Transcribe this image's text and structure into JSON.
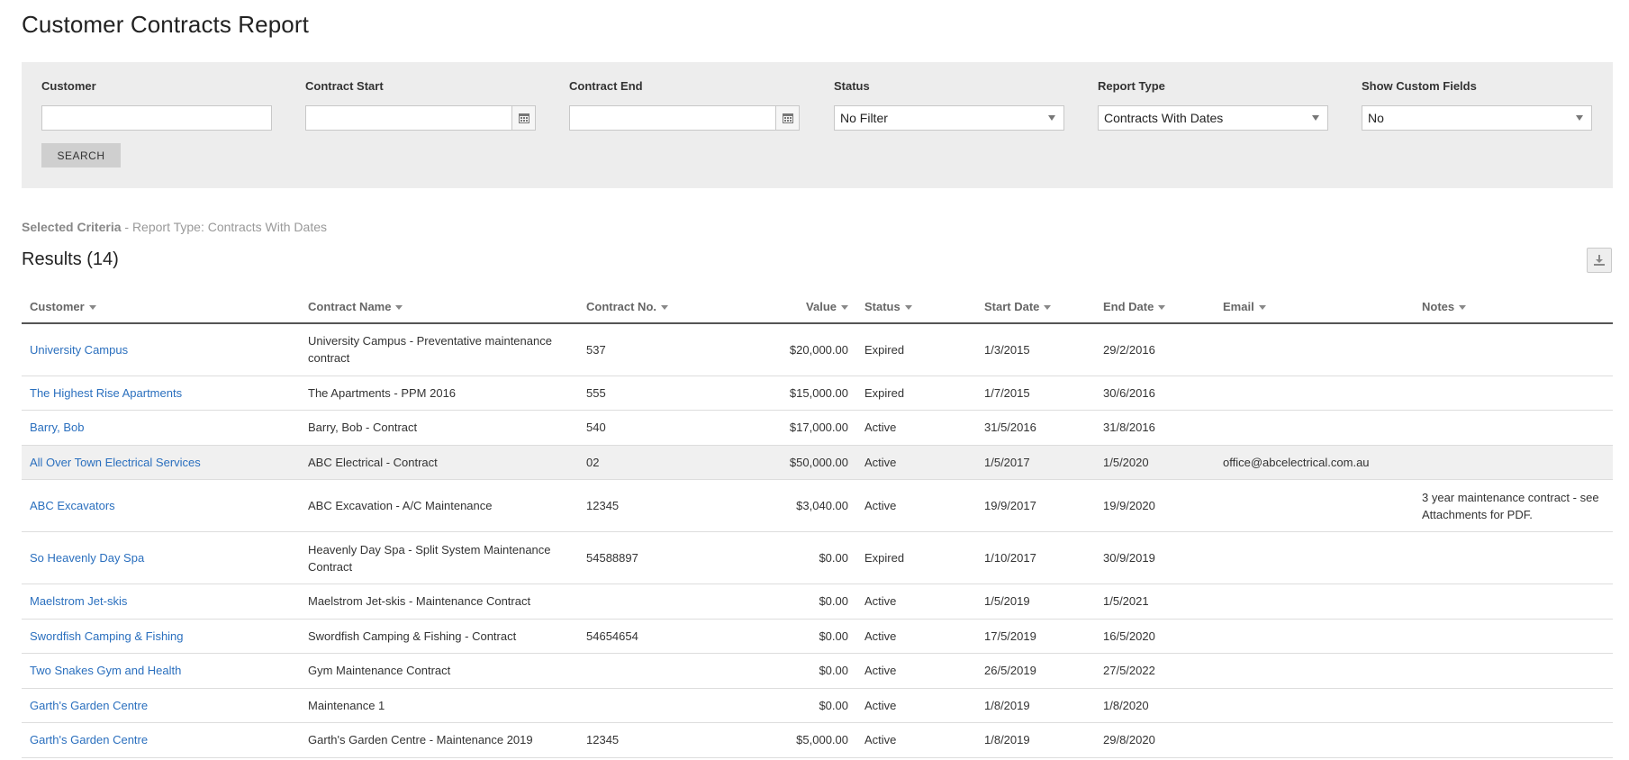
{
  "page": {
    "title": "Customer Contracts Report"
  },
  "filters": {
    "customer": {
      "label": "Customer",
      "value": ""
    },
    "contract_start": {
      "label": "Contract Start",
      "value": ""
    },
    "contract_end": {
      "label": "Contract End",
      "value": ""
    },
    "status": {
      "label": "Status",
      "value": "No Filter"
    },
    "report_type": {
      "label": "Report Type",
      "value": "Contracts With Dates"
    },
    "show_custom_fields": {
      "label": "Show Custom Fields",
      "value": "No"
    },
    "search_label": "SEARCH"
  },
  "criteria": {
    "label": "Selected Criteria",
    "text": " - Report Type: Contracts With Dates"
  },
  "results": {
    "title": "Results (14)",
    "columns": [
      "Customer",
      "Contract Name",
      "Contract No.",
      "Value",
      "Status",
      "Start Date",
      "End Date",
      "Email",
      "Notes"
    ],
    "rows": [
      {
        "customer": "University Campus",
        "contract_name": "University Campus - Preventative maintenance contract",
        "contract_no": "537",
        "value": "$20,000.00",
        "status": "Expired",
        "start": "1/3/2015",
        "end": "29/2/2016",
        "email": "",
        "notes": ""
      },
      {
        "customer": "The Highest Rise Apartments",
        "contract_name": "The Apartments - PPM 2016",
        "contract_no": "555",
        "value": "$15,000.00",
        "status": "Expired",
        "start": "1/7/2015",
        "end": "30/6/2016",
        "email": "",
        "notes": ""
      },
      {
        "customer": "Barry, Bob",
        "contract_name": "Barry, Bob - Contract",
        "contract_no": "540",
        "value": "$17,000.00",
        "status": "Active",
        "start": "31/5/2016",
        "end": "31/8/2016",
        "email": "",
        "notes": ""
      },
      {
        "customer": "All Over Town Electrical Services",
        "contract_name": "ABC Electrical - Contract",
        "contract_no": "02",
        "value": "$50,000.00",
        "status": "Active",
        "start": "1/5/2017",
        "end": "1/5/2020",
        "email": "office@abcelectrical.com.au",
        "notes": ""
      },
      {
        "customer": "ABC Excavators",
        "contract_name": "ABC Excavation - A/C Maintenance",
        "contract_no": "12345",
        "value": "$3,040.00",
        "status": "Active",
        "start": "19/9/2017",
        "end": "19/9/2020",
        "email": "",
        "notes": "3 year maintenance contract - see Attachments for PDF."
      },
      {
        "customer": "So Heavenly Day Spa",
        "contract_name": "Heavenly Day Spa - Split System Maintenance Contract",
        "contract_no": "54588897",
        "value": "$0.00",
        "status": "Expired",
        "start": "1/10/2017",
        "end": "30/9/2019",
        "email": "",
        "notes": ""
      },
      {
        "customer": "Maelstrom Jet-skis",
        "contract_name": "Maelstrom Jet-skis - Maintenance Contract",
        "contract_no": "",
        "value": "$0.00",
        "status": "Active",
        "start": "1/5/2019",
        "end": "1/5/2021",
        "email": "",
        "notes": ""
      },
      {
        "customer": "Swordfish Camping & Fishing",
        "contract_name": "Swordfish Camping & Fishing - Contract",
        "contract_no": "54654654",
        "value": "$0.00",
        "status": "Active",
        "start": "17/5/2019",
        "end": "16/5/2020",
        "email": "",
        "notes": ""
      },
      {
        "customer": "Two Snakes Gym and Health",
        "contract_name": "Gym Maintenance Contract",
        "contract_no": "",
        "value": "$0.00",
        "status": "Active",
        "start": "26/5/2019",
        "end": "27/5/2022",
        "email": "",
        "notes": ""
      },
      {
        "customer": "Garth's Garden Centre",
        "contract_name": "Maintenance 1",
        "contract_no": "",
        "value": "$0.00",
        "status": "Active",
        "start": "1/8/2019",
        "end": "1/8/2020",
        "email": "",
        "notes": ""
      },
      {
        "customer": "Garth's Garden Centre",
        "contract_name": "Garth's Garden Centre - Maintenance 2019",
        "contract_no": "12345",
        "value": "$5,000.00",
        "status": "Active",
        "start": "1/8/2019",
        "end": "29/8/2020",
        "email": "",
        "notes": ""
      }
    ]
  }
}
